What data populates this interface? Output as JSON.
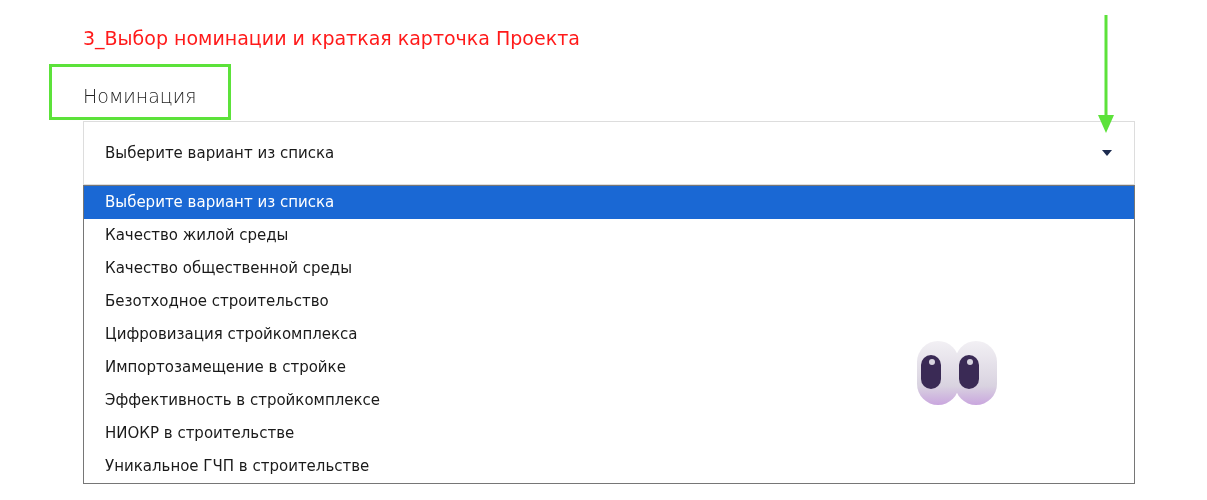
{
  "section_title": "3_Выбор номинации и краткая карточка Проекта",
  "field": {
    "label": "Номинация",
    "value": "Выберите вариант из списка",
    "expanded": true
  },
  "options": [
    {
      "label": "Выберите вариант из списка",
      "selected": true
    },
    {
      "label": "Качество жилой среды",
      "selected": false
    },
    {
      "label": "Качество общественной среды",
      "selected": false
    },
    {
      "label": "Безотходное строительство",
      "selected": false
    },
    {
      "label": "Цифровизация стройкомплекса",
      "selected": false
    },
    {
      "label": "Импортозамещение в стройке",
      "selected": false
    },
    {
      "label": "Эффективность в стройкомплексе",
      "selected": false
    },
    {
      "label": "НИОКР в строительстве",
      "selected": false
    },
    {
      "label": "Уникальное ГЧП в строительстве",
      "selected": false
    }
  ]
}
